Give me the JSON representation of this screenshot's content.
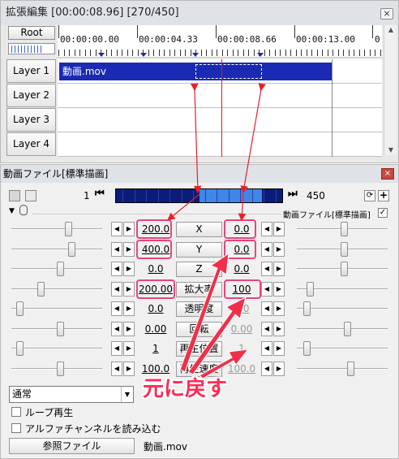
{
  "timeline_window": {
    "title": "拡張編集 [00:00:08.96] [270/450]",
    "close": "×",
    "root_button": "Root",
    "time_ticks": [
      "00:00:00.00",
      "00:00:04.33",
      "00:00:08.66",
      "00:00:13.00",
      "0"
    ],
    "layers": [
      "Layer 1",
      "Layer 2",
      "Layer 3",
      "Layer 4"
    ],
    "clip_name": "動画.mov",
    "scroll_up": "▲",
    "scroll_down": "▼"
  },
  "settings_window": {
    "title": "動画ファイル[標準描画]",
    "close": "×",
    "frame_start": "1",
    "frame_end": "450",
    "prev_icon": "⏮",
    "next_icon": "⏭",
    "plus": "+",
    "filter_label": "動画ファイル[標準描画]",
    "parameters": [
      {
        "label": "X",
        "left": "200.0",
        "right": "0.0",
        "left_hl": true,
        "right_hl": true
      },
      {
        "label": "Y",
        "left": "400.0",
        "right": "0.0",
        "left_hl": true,
        "right_hl": true
      },
      {
        "label": "Z",
        "left": "0.0",
        "right": "0.0",
        "left_hl": false,
        "right_hl": false
      },
      {
        "label": "拡大率",
        "left": "200.00",
        "right": "100",
        "left_hl": true,
        "right_hl": true
      },
      {
        "label": "透明度",
        "left": "0.0",
        "right": "0.0",
        "left_hl": false,
        "right_hl": false
      },
      {
        "label": "回転",
        "left": "0.00",
        "right": "0.00",
        "left_hl": false,
        "right_hl": false
      },
      {
        "label": "再生位置",
        "left": "1",
        "right": "1",
        "left_hl": false,
        "right_hl": false
      },
      {
        "label": "再生速度",
        "left": "100.0",
        "right": "100.0",
        "left_hl": false,
        "right_hl": false
      }
    ],
    "blend_mode": "通常",
    "loop_label": "ループ再生",
    "alpha_label": "アルファチャンネルを読み込む",
    "reference_button": "参照ファイル",
    "file_name": "動画.mov"
  },
  "annotation": {
    "callout": "元に戻す",
    "color": "#ff2a56"
  },
  "colors": {
    "clip": "#1a2ab2",
    "frame_bar": "#0b1b78",
    "frame_selection": "#3f86e8",
    "highlight": "#e8457a",
    "playhead": "#d8201f"
  }
}
